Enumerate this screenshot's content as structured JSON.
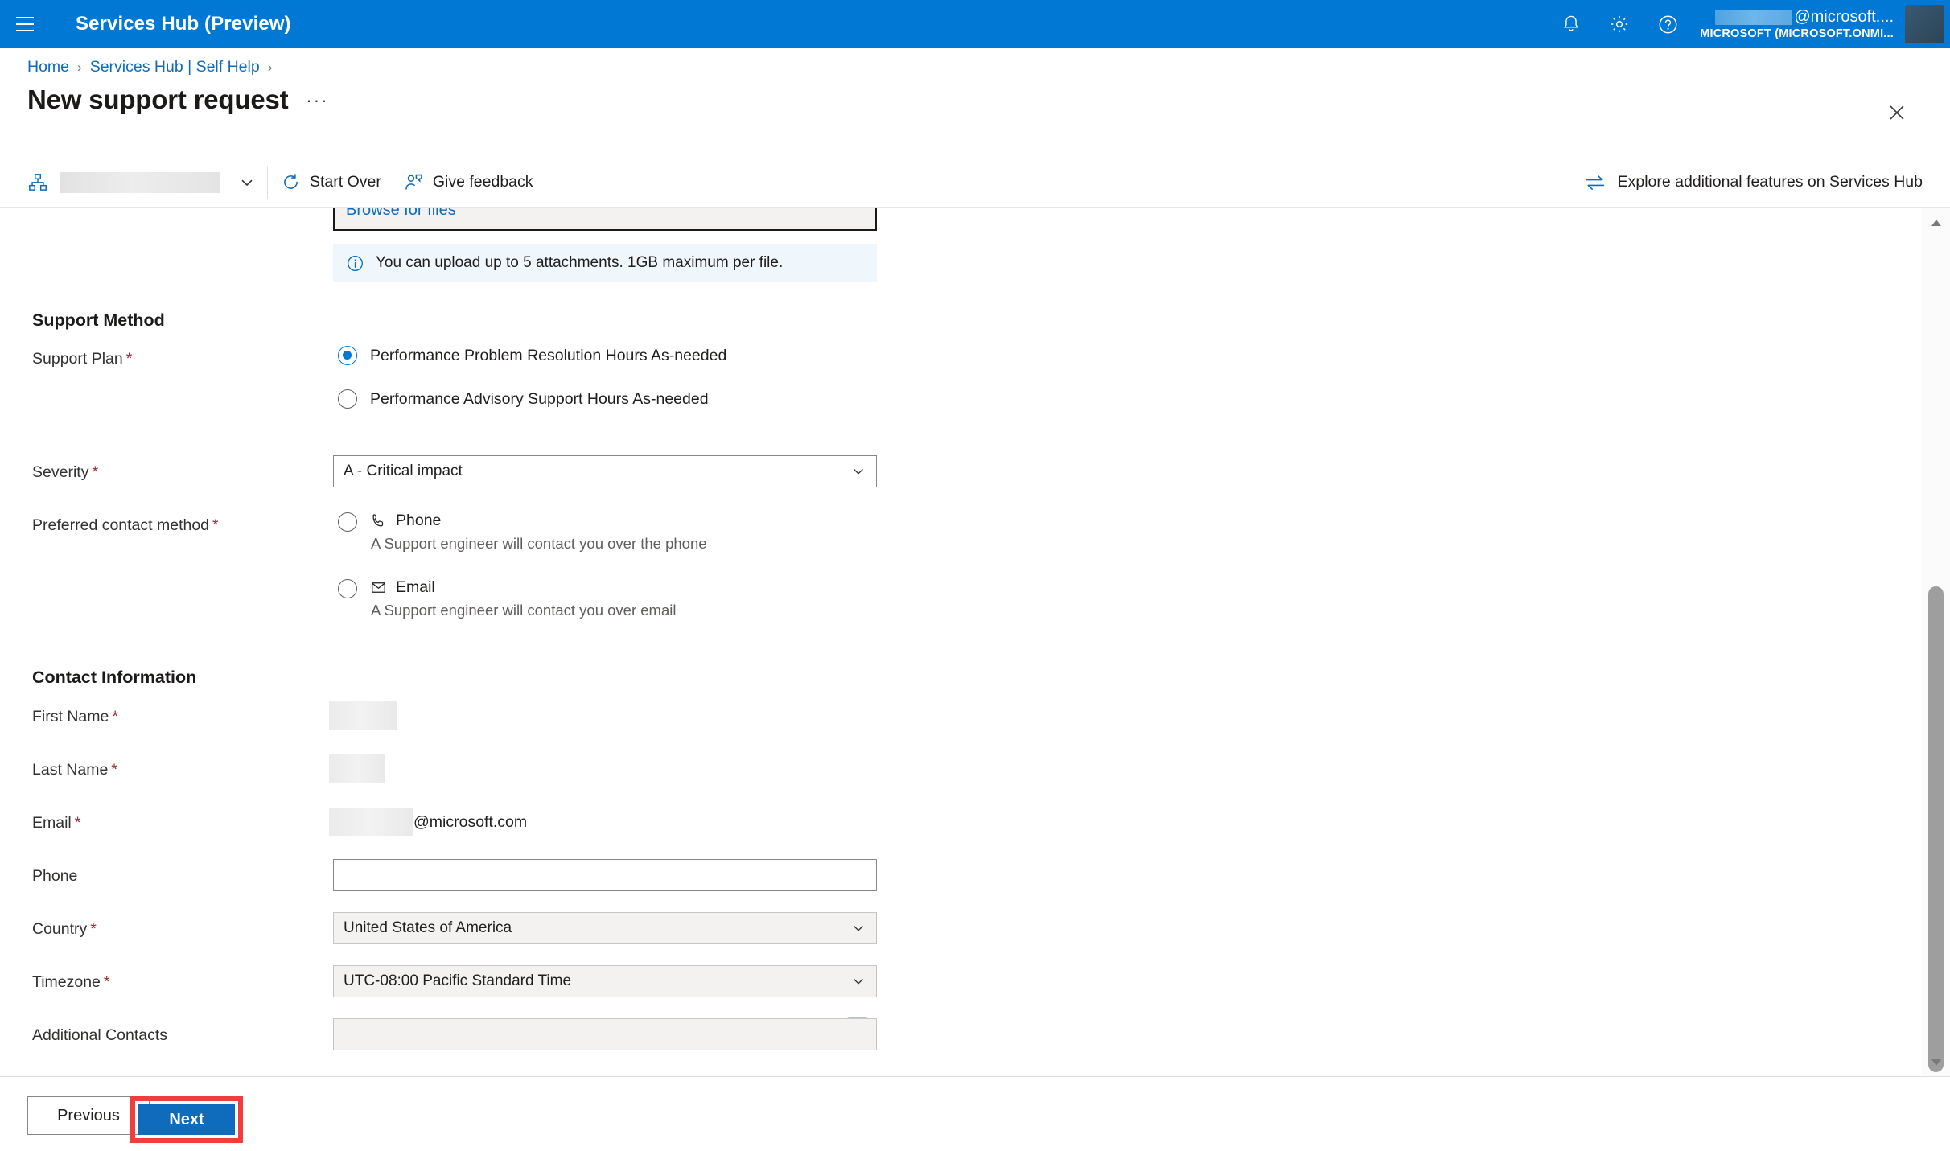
{
  "topbar": {
    "app_title": "Services Hub (Preview)",
    "hamburger_label": "Global navigation",
    "notifications_label": "Notifications",
    "settings_label": "Settings",
    "help_label": "Help",
    "account_domain": "@microsoft....",
    "account_org": "MICROSOFT (MICROSOFT.ONMI..."
  },
  "breadcrumb": {
    "home": "Home",
    "self_help": "Services Hub | Self Help",
    "separator": "›"
  },
  "page": {
    "title": "New support request",
    "ellipsis": "···",
    "close_label": "Close"
  },
  "commandbar": {
    "start_over": "Start Over",
    "give_feedback": "Give feedback",
    "explore": "Explore additional features on Services Hub"
  },
  "attachments": {
    "browse_label": "Browse for files",
    "info": "You can upload up to 5 attachments. 1GB maximum per file."
  },
  "support_method": {
    "heading": "Support Method",
    "support_plan_label": "Support Plan",
    "plans": [
      {
        "label": "Performance Problem Resolution Hours As-needed",
        "selected": true
      },
      {
        "label": "Performance Advisory Support Hours As-needed",
        "selected": false
      }
    ],
    "severity_label": "Severity",
    "severity_value": "A - Critical impact",
    "contact_method_label": "Preferred contact method",
    "contact_methods": [
      {
        "title": "Phone",
        "description": "A Support engineer will contact you over the phone",
        "icon": "phone-icon",
        "selected": false
      },
      {
        "title": "Email",
        "description": "A Support engineer will contact you over email",
        "icon": "mail-icon",
        "selected": false
      }
    ]
  },
  "contact_information": {
    "heading": "Contact Information",
    "first_name_label": "First Name",
    "last_name_label": "Last Name",
    "email_label": "Email",
    "email_domain": "@microsoft.com",
    "phone_label": "Phone",
    "phone_value": "",
    "country_label": "Country",
    "country_value": "United States of America",
    "timezone_label": "Timezone",
    "timezone_value": "UTC-08:00 Pacific Standard Time",
    "additional_contacts_label": "Additional Contacts",
    "additional_contacts_value": "",
    "required_marker": "*"
  },
  "footer": {
    "previous": "Previous",
    "next": "Next"
  },
  "colors": {
    "brand_blue": "#0078d4",
    "link_blue": "#0f6cbd",
    "required_red": "#a4262c",
    "highlight_red": "#f03e3e",
    "info_bg": "#eff6fc"
  }
}
